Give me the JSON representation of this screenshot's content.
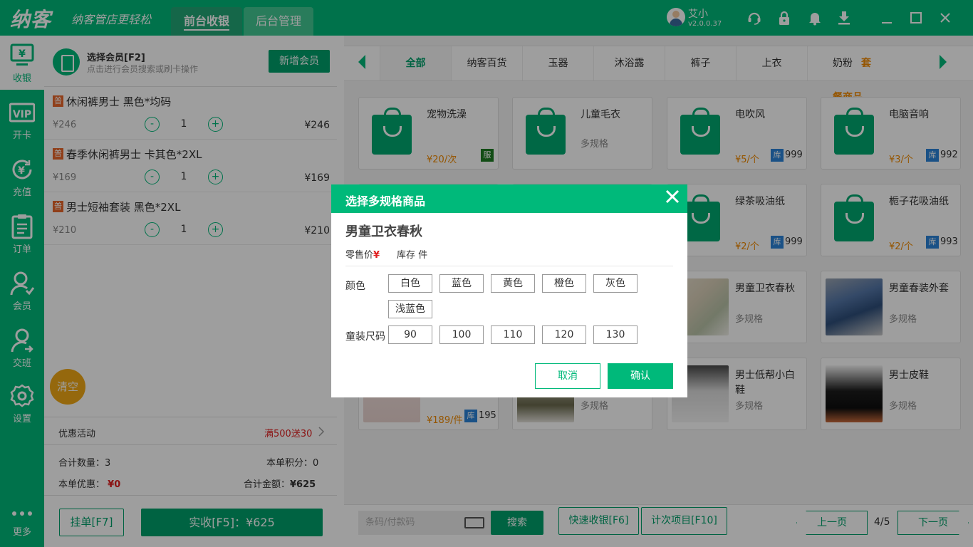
{
  "app": {
    "logo": "纳客",
    "slogan": "纳客管店更轻松",
    "tabs": [
      {
        "label": "前台收银"
      },
      {
        "label": "后台管理"
      }
    ],
    "user": {
      "name": "艾小",
      "version": "v2.0.0.37"
    }
  },
  "titlebar_icons": [
    "headset-icon",
    "lock-icon",
    "bell-icon",
    "download-icon",
    "minimize-icon",
    "maximize-icon",
    "close-icon"
  ],
  "sidebar": {
    "items": [
      {
        "label": "收银",
        "icon": "cashier-icon"
      },
      {
        "label": "开卡",
        "icon": "vip-card-icon"
      },
      {
        "label": "充值",
        "icon": "recharge-icon"
      },
      {
        "label": "订单",
        "icon": "orders-icon"
      },
      {
        "label": "会员",
        "icon": "member-icon"
      },
      {
        "label": "交班",
        "icon": "shift-icon"
      },
      {
        "label": "设置",
        "icon": "settings-icon"
      },
      {
        "label": "更多",
        "icon": "more-icon"
      }
    ]
  },
  "member": {
    "title": "选择会员[F2]",
    "subtitle": "点击进行会员搜索或刷卡操作",
    "add_label": "新增会员"
  },
  "cart": {
    "items": [
      {
        "badge": "普",
        "name": "休闲裤男士 黑色*均码",
        "price": "¥246",
        "qty": "1",
        "subtotal": "¥246"
      },
      {
        "badge": "普",
        "name": "春季休闲裤男士 卡其色*2XL",
        "price": "¥169",
        "qty": "1",
        "subtotal": "¥169"
      },
      {
        "badge": "普",
        "name": "男士短袖套装 黑色*2XL",
        "price": "¥210",
        "qty": "1",
        "subtotal": "¥210"
      }
    ],
    "minus": "-",
    "plus": "+",
    "clear_label": "清空"
  },
  "promo": {
    "label": "优惠活动",
    "value": "满500送30"
  },
  "summary": {
    "total_qty_label": "合计数量：",
    "total_qty": "3",
    "points_label": "本单积分：",
    "points": "0",
    "discount_label": "本单优惠：",
    "discount": "¥0",
    "amount_label": "合计金额：",
    "amount": "¥625"
  },
  "actions": {
    "hold_label": "挂单[F7]",
    "pay_label": "实收[F5]：¥625"
  },
  "categories": {
    "items": [
      "全部",
      "纳客百货",
      "玉器",
      "沐浴露",
      "裤子",
      "上衣",
      "奶粉"
    ],
    "extra": "套餐商品"
  },
  "products": [
    {
      "name": "宠物洗澡",
      "price": "¥20/次",
      "tag": "服",
      "kind": "bag"
    },
    {
      "name": "儿童毛衣",
      "spec": "多规格",
      "kind": "bag"
    },
    {
      "name": "电吹风",
      "price": "¥5/个",
      "stock": "999",
      "kind": "bag"
    },
    {
      "name": "电脑音响",
      "price": "¥3/个",
      "stock": "992",
      "kind": "bag"
    },
    {
      "name": "",
      "kind": "bag",
      "hidden": true
    },
    {
      "name": "",
      "kind": "bag",
      "hidden": true
    },
    {
      "name": "绿茶吸油纸",
      "price": "¥2/个",
      "stock": "999",
      "kind": "bag"
    },
    {
      "name": "栀子花吸油纸",
      "price": "¥2/个",
      "stock": "993",
      "kind": "bag"
    },
    {
      "name": "",
      "kind": "photo",
      "hidden": true
    },
    {
      "name": "",
      "kind": "photo",
      "hidden": true
    },
    {
      "name": "男童卫衣春秋",
      "spec": "多规格",
      "kind": "photo"
    },
    {
      "name": "男童春装外套",
      "spec": "多规格",
      "kind": "photo"
    },
    {
      "name": "",
      "price": "¥189/件",
      "stock": "195",
      "kind": "photo"
    },
    {
      "name": "",
      "spec": "多规格",
      "kind": "photo"
    },
    {
      "name": "男士低帮小白鞋",
      "spec": "多规格",
      "kind": "photo"
    },
    {
      "name": "男士皮鞋",
      "spec": "多规格",
      "kind": "photo"
    }
  ],
  "stock_badge": "库",
  "bottom": {
    "barcode_placeholder": "条码/付款码",
    "search_label": "搜索",
    "quick_label": "快速收银[F6]",
    "count_label": "计次项目[F10]",
    "prev_label": "上一页",
    "page": "4/5",
    "next_label": "下一页"
  },
  "modal": {
    "title": "选择多规格商品",
    "product": "男童卫衣春秋",
    "price_label": "零售价",
    "price_symbol": "¥",
    "stock_label": "库存 件",
    "color_label": "颜色",
    "colors": [
      "白色",
      "蓝色",
      "黄色",
      "橙色",
      "灰色",
      "浅蓝色"
    ],
    "size_label": "童装尺码",
    "sizes": [
      "90",
      "100",
      "110",
      "120",
      "130"
    ],
    "cancel_label": "取消",
    "confirm_label": "确认"
  }
}
